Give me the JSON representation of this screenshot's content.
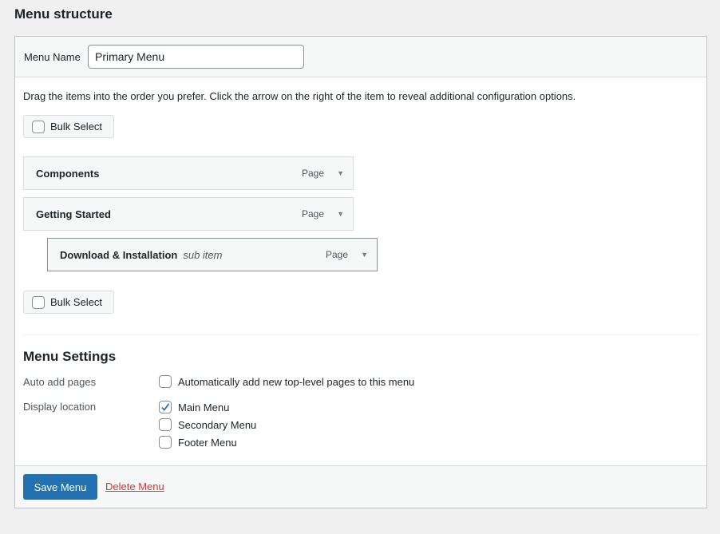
{
  "title": "Menu structure",
  "menu_name": {
    "label": "Menu Name",
    "value": "Primary Menu"
  },
  "instructions": "Drag the items into the order you prefer. Click the arrow on the right of the item to reveal additional configuration options.",
  "bulk_select": "Bulk Select",
  "items": [
    {
      "title": "Components",
      "type": "Page"
    },
    {
      "title": "Getting Started",
      "type": "Page"
    },
    {
      "title": "Download & Installation",
      "sub": "sub item",
      "type": "Page"
    }
  ],
  "settings": {
    "heading": "Menu Settings",
    "auto_add_label": "Auto add pages",
    "auto_add_option": "Automatically add new top-level pages to this menu",
    "auto_add_checked": false,
    "display_label": "Display location",
    "locations": [
      {
        "label": "Main Menu",
        "checked": true
      },
      {
        "label": "Secondary Menu",
        "checked": false
      },
      {
        "label": "Footer Menu",
        "checked": false
      }
    ]
  },
  "footer": {
    "save": "Save Menu",
    "delete": "Delete Menu"
  },
  "colors": {
    "primary": "#2271b1",
    "danger": "#d63638"
  }
}
